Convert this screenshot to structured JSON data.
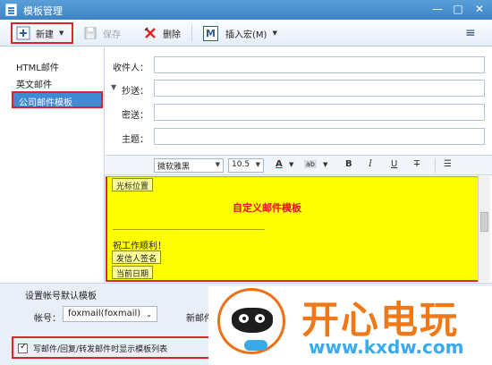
{
  "window": {
    "title": "模板管理",
    "minimize": "—",
    "maximize": "□",
    "close": "✕"
  },
  "toolbar": {
    "new_label": "新建",
    "save_label": "保存",
    "delete_label": "删除",
    "insert_macro_label": "插入宏(M)",
    "macro_badge": "M",
    "menu_icon": "≡"
  },
  "sidebar": {
    "items": [
      {
        "label": "HTML邮件"
      },
      {
        "label": "英文邮件"
      },
      {
        "label": "公司邮件模板"
      }
    ]
  },
  "form": {
    "to_label": "收件人：",
    "cc_label": "抄送：",
    "bcc_label": "密送：",
    "subject_label": "主题：",
    "to_value": "",
    "cc_value": "",
    "bcc_value": "",
    "subject_value": ""
  },
  "format_bar": {
    "font": "微软雅黑",
    "size": "10.5",
    "font_color": "A",
    "highlight": "ab",
    "bold": "B",
    "italic": "I",
    "underline": "U",
    "strike": "T",
    "list": "☰"
  },
  "editor": {
    "cursor_chip": "光标位置",
    "heading": "自定义邮件模板",
    "wish": "祝工作顺利！",
    "sender_sig_chip": "发信人签名",
    "date_chip": "当前日期"
  },
  "defaults": {
    "section_title": "设置帐号默认模板",
    "account_label": "帐号：",
    "account_value": "foxmail(foxmail)",
    "new_mail_label": "新邮件",
    "show_list_label": "写邮件/回复/转发邮件时显示模板列表",
    "show_list_checked": true
  },
  "watermark": {
    "brand": "开心电玩",
    "domain": "www.kxdw.com"
  },
  "colors": {
    "accent": "#3d84c6",
    "highlight_box": "#d9252a",
    "editor_bg": "#ffff00",
    "heading_red": "#e21616"
  }
}
